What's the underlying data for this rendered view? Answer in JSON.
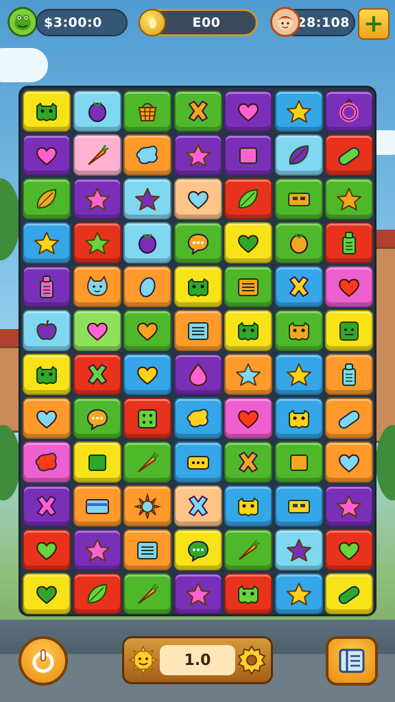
{
  "hud": {
    "money": "$3:00:0",
    "coins": "E00",
    "lives": "28:108",
    "plus": "+"
  },
  "bottom": {
    "level": "1.0"
  },
  "colors": {
    "yellow": "#f7e317",
    "cyan": "#7fd7f2",
    "green": "#4fb82a",
    "purple": "#7a2fb8",
    "blue": "#35a6e8",
    "pink": "#ffb2cf",
    "orange": "#ff9a2b",
    "red": "#e8321c",
    "magenta": "#ee5fd0",
    "lime": "#8ee05a",
    "peach": "#ffc487"
  },
  "board": {
    "rows": [
      [
        [
          "yellow",
          "monster-icon"
        ],
        [
          "cyan",
          "berry-icon"
        ],
        [
          "green",
          "basket-icon"
        ],
        [
          "green",
          "x-icon"
        ],
        [
          "purple",
          "heart-icon"
        ],
        [
          "blue",
          "star-icon"
        ],
        [
          "purple",
          "ring-icon"
        ]
      ],
      [
        [
          "purple",
          "heart-icon"
        ],
        [
          "pink",
          "carrot-icon"
        ],
        [
          "orange",
          "blob-icon"
        ],
        [
          "purple",
          "star-icon"
        ],
        [
          "purple",
          "square-icon"
        ],
        [
          "cyan",
          "leaf-icon"
        ],
        [
          "red",
          "pill-icon"
        ]
      ],
      [
        [
          "green",
          "leaf-icon"
        ],
        [
          "purple",
          "star-icon"
        ],
        [
          "cyan",
          "star-icon"
        ],
        [
          "peach",
          "heart-icon"
        ],
        [
          "red",
          "leaf-icon"
        ],
        [
          "green",
          "ticket-icon"
        ],
        [
          "green",
          "star-icon"
        ]
      ],
      [
        [
          "blue",
          "star-icon"
        ],
        [
          "red",
          "star-icon"
        ],
        [
          "cyan",
          "berry-icon"
        ],
        [
          "green",
          "bubble-icon"
        ],
        [
          "yellow",
          "heart-icon"
        ],
        [
          "green",
          "berry-icon"
        ],
        [
          "red",
          "bottle-icon"
        ]
      ],
      [
        [
          "purple",
          "bottle-icon"
        ],
        [
          "orange",
          "cat-icon"
        ],
        [
          "orange",
          "bean-icon"
        ],
        [
          "yellow",
          "monster-icon"
        ],
        [
          "green",
          "list-icon"
        ],
        [
          "blue",
          "x-icon"
        ],
        [
          "magenta",
          "heart-icon"
        ]
      ],
      [
        [
          "cyan",
          "apple-icon"
        ],
        [
          "lime",
          "heart-icon"
        ],
        [
          "green",
          "heart-icon"
        ],
        [
          "orange",
          "list-icon"
        ],
        [
          "yellow",
          "monster-icon"
        ],
        [
          "green",
          "monster-icon"
        ],
        [
          "yellow",
          "face-icon"
        ]
      ],
      [
        [
          "yellow",
          "monster-icon"
        ],
        [
          "red",
          "x-icon"
        ],
        [
          "blue",
          "heart-icon"
        ],
        [
          "purple",
          "drop-icon"
        ],
        [
          "orange",
          "star-icon"
        ],
        [
          "blue",
          "star-icon"
        ],
        [
          "orange",
          "bottle-icon"
        ]
      ],
      [
        [
          "orange",
          "heart-icon"
        ],
        [
          "green",
          "bubble-icon"
        ],
        [
          "red",
          "dice-icon"
        ],
        [
          "blue",
          "blob-icon"
        ],
        [
          "magenta",
          "heart-icon"
        ],
        [
          "blue",
          "monster-icon"
        ],
        [
          "orange",
          "pill-icon"
        ]
      ],
      [
        [
          "magenta",
          "blob-icon"
        ],
        [
          "yellow",
          "square-icon"
        ],
        [
          "green",
          "carrot-icon"
        ],
        [
          "blue",
          "dots-icon"
        ],
        [
          "green",
          "x-icon"
        ],
        [
          "green",
          "square-icon"
        ],
        [
          "orange",
          "heart-icon"
        ]
      ],
      [
        [
          "purple",
          "x-icon"
        ],
        [
          "orange",
          "card-icon"
        ],
        [
          "orange",
          "sun-icon"
        ],
        [
          "peach",
          "x-icon"
        ],
        [
          "blue",
          "monster-icon"
        ],
        [
          "blue",
          "ticket-icon"
        ],
        [
          "purple",
          "star-icon"
        ]
      ],
      [
        [
          "red",
          "heart-icon"
        ],
        [
          "purple",
          "star-icon"
        ],
        [
          "orange",
          "list-icon"
        ],
        [
          "yellow",
          "bubble-icon"
        ],
        [
          "green",
          "carrot-icon"
        ],
        [
          "cyan",
          "star-icon"
        ],
        [
          "red",
          "heart-icon"
        ]
      ],
      [
        [
          "yellow",
          "heart-icon"
        ],
        [
          "red",
          "leaf-icon"
        ],
        [
          "green",
          "carrot-icon"
        ],
        [
          "purple",
          "star-icon"
        ],
        [
          "red",
          "monster-icon"
        ],
        [
          "blue",
          "star-icon"
        ],
        [
          "yellow",
          "pill-icon"
        ]
      ]
    ]
  }
}
